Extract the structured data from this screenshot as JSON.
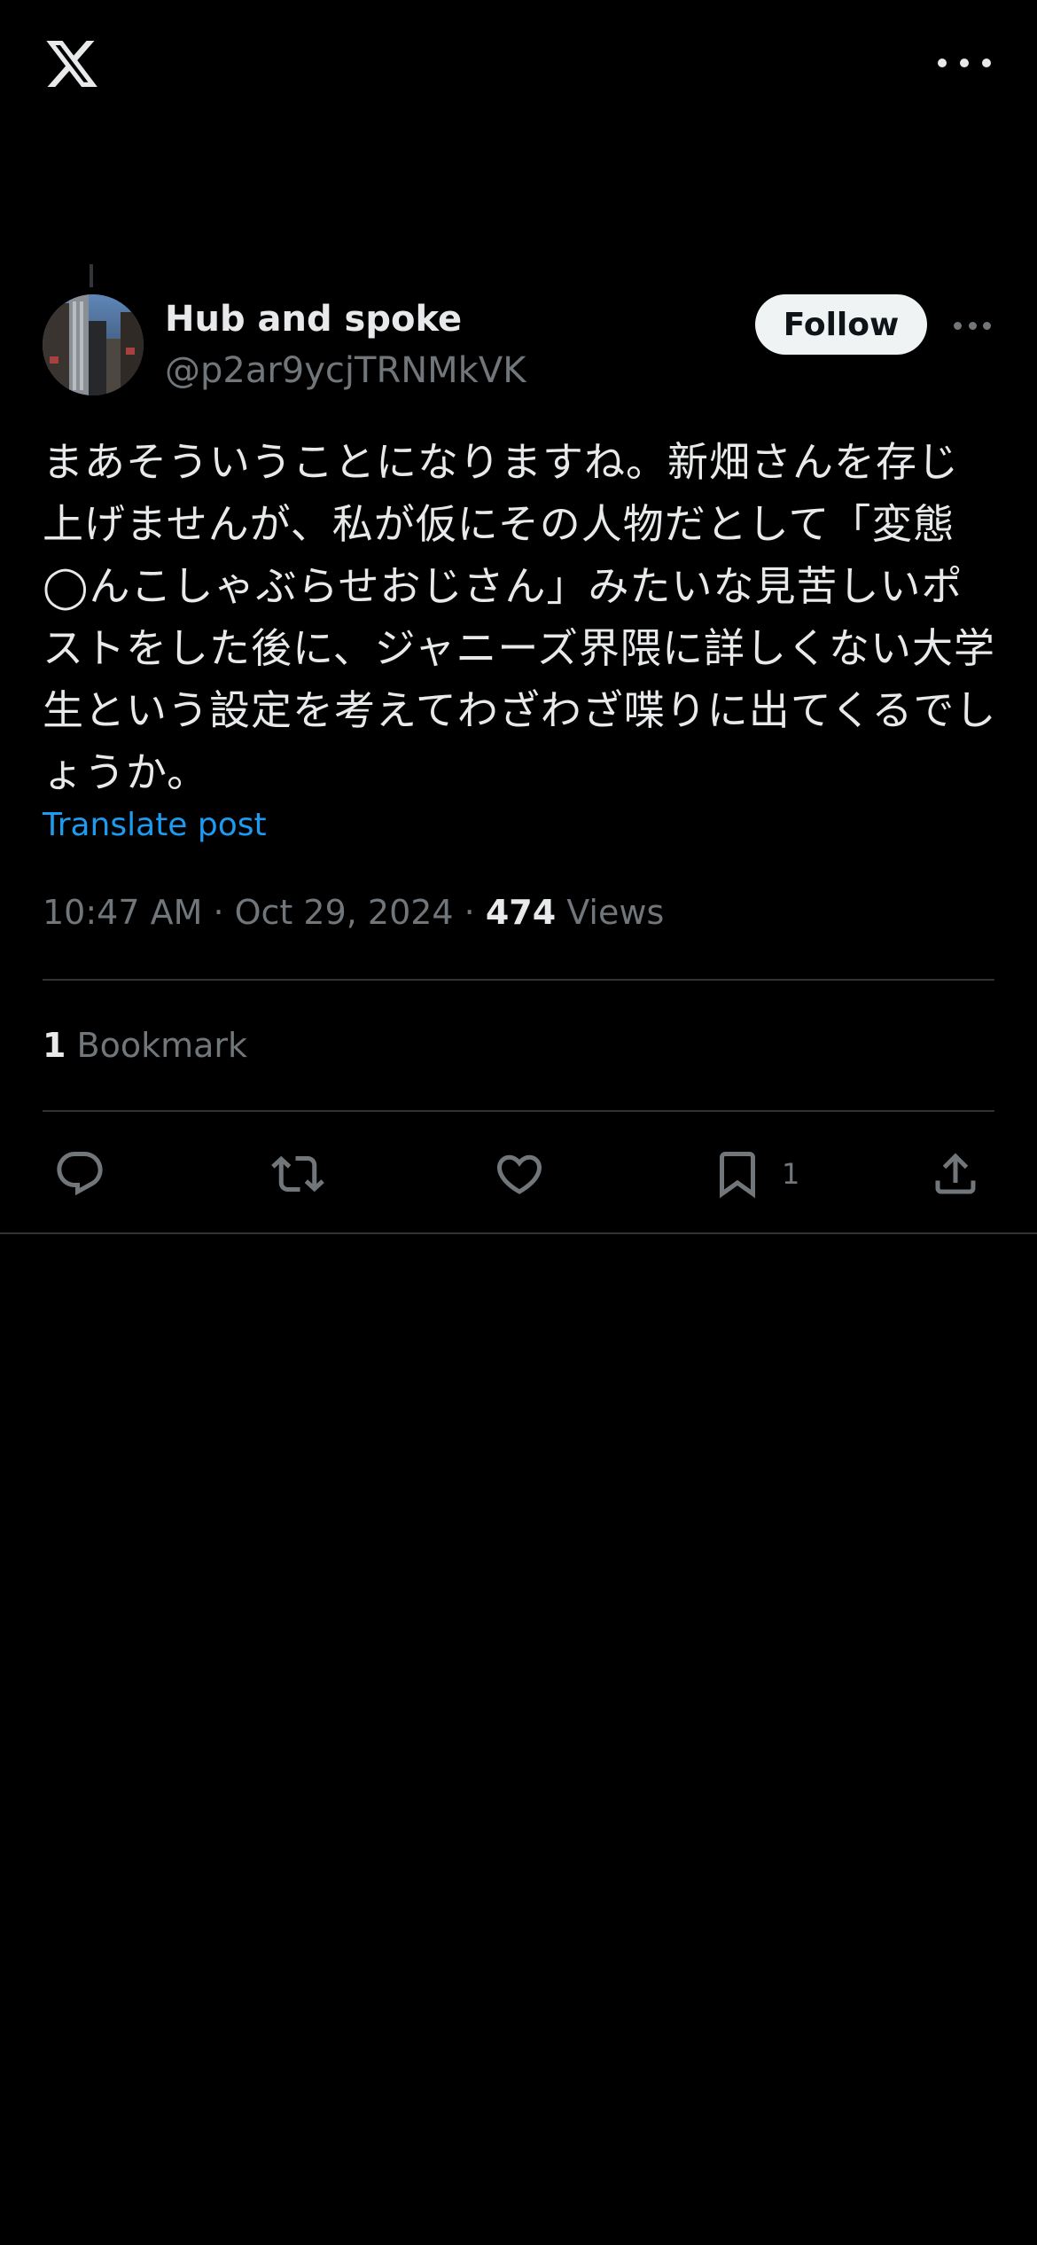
{
  "header": {
    "logo_icon": "x-logo-icon",
    "more_icon": "more-horizontal-icon"
  },
  "post": {
    "author": {
      "name": "Hub and spoke",
      "handle": "@p2ar9ycjTRNMkVK",
      "avatar_icon": "avatar-city-photo"
    },
    "follow_label": "Follow",
    "text": "まあそういうことになりますね。新畑さんを存じ上げませんが、私が仮にその人物だとして「変態◯んこしゃぶらせおじさん」みたいな見苦しいポストをした後に、ジャニーズ界隈に詳しくない大学生という設定を考えてわざわざ喋りに出てくるでしょうか。",
    "translate_label": "Translate post",
    "timestamp": "10:47 AM · Oct 29, 2024 · ",
    "views_count": "474",
    "views_label": " Views",
    "bookmarks_count": "1",
    "bookmarks_label": " Bookmark"
  },
  "actions": {
    "reply_icon": "reply-icon",
    "repost_icon": "repost-icon",
    "like_icon": "like-icon",
    "bookmark_icon": "bookmark-icon",
    "bookmark_count": "1",
    "share_icon": "share-icon"
  },
  "colors": {
    "background": "#000000",
    "text": "#e7e9ea",
    "secondary": "#71767b",
    "link": "#1d9bf0",
    "divider": "#2f3336"
  }
}
